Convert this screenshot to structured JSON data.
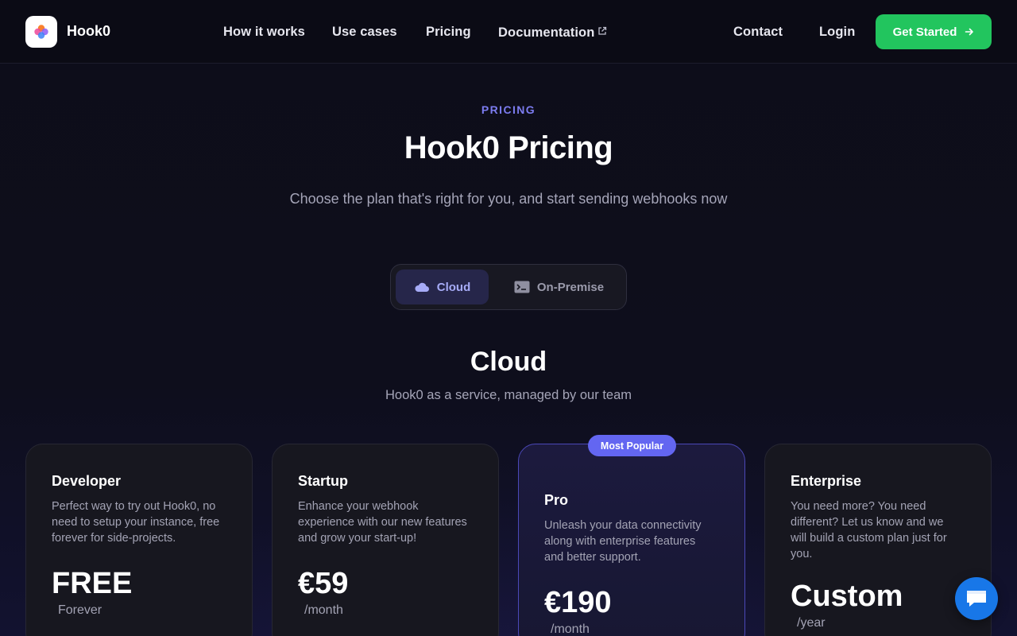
{
  "nav": {
    "brand": "Hook0",
    "links": [
      {
        "label": "How it works"
      },
      {
        "label": "Use cases"
      },
      {
        "label": "Pricing"
      },
      {
        "label": "Documentation",
        "icon": "external-link-icon"
      }
    ],
    "contact": "Contact",
    "login": "Login",
    "cta": "Get Started",
    "cta_icon": "arrow-right-icon"
  },
  "hero": {
    "eyebrow": "PRICING",
    "title": "Hook0 Pricing",
    "subtitle": "Choose the plan that's right for you, and start sending webhooks now"
  },
  "toggle": {
    "options": [
      {
        "label": "Cloud",
        "icon": "cloud-icon",
        "selected": true
      },
      {
        "label": "On-Premise",
        "icon": "terminal-icon",
        "selected": false
      }
    ]
  },
  "section": {
    "title": "Cloud",
    "subtitle": "Hook0 as a service, managed by our team"
  },
  "plans": [
    {
      "name": "Developer",
      "description": "Perfect way to try out Hook0, no need to setup your instance, free forever for side-projects.",
      "price": "FREE",
      "period": "Forever"
    },
    {
      "name": "Startup",
      "description": "Enhance your webhook experience with our new features and grow your start-up!",
      "price": "€59",
      "period": "/month"
    },
    {
      "name": "Pro",
      "description": "Unleash your data connectivity along with enterprise features and better support.",
      "price": "€190",
      "period": "/month",
      "badge": "Most Popular"
    },
    {
      "name": "Enterprise",
      "description": "You need more? You need different? Let us know and we will build a custom plan just for you.",
      "price": "Custom",
      "period": "/year"
    }
  ],
  "chat": {
    "icon": "chat-icon"
  },
  "colors": {
    "accent": "#6366f1",
    "cta_green": "#22c55e",
    "background": "#0d0d19",
    "chat_blue": "#1877e8"
  }
}
